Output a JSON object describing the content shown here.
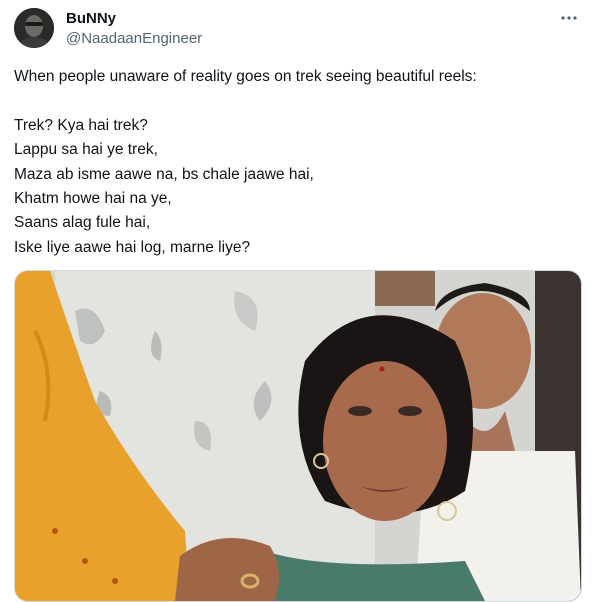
{
  "author": {
    "name": "BuNNy",
    "handle": "@NaadaanEngineer"
  },
  "menu_icon": "more-horizontal-icon",
  "tweet": {
    "lines": [
      "When people unaware of reality goes on trek seeing beautiful reels:",
      "",
      "Trek? Kya hai trek?",
      "Lappu sa hai ye trek,",
      "Maza ab isme aawe na, bs chale jaawe hai,",
      "Khatm howe hai na ye,",
      "Saans alag fule hai,",
      "Iske liye aawe hai log, marne liye?"
    ]
  },
  "colors": {
    "text": "#0f1419",
    "secondary": "#536471",
    "border": "#cfd9de"
  }
}
